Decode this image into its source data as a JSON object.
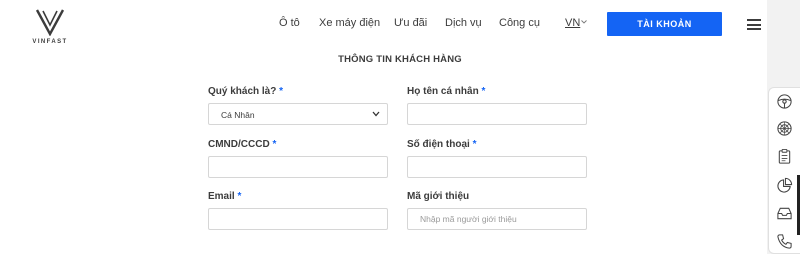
{
  "brand": {
    "logo_text": "VINFAST"
  },
  "nav": {
    "items": [
      "Ô tô",
      "Xe máy điện",
      "Ưu đãi",
      "Dịch vụ",
      "Công cụ"
    ],
    "language": "VN",
    "account_label": "TÀI KHOẢN"
  },
  "form": {
    "title": "THÔNG TIN KHÁCH HÀNG",
    "customer_type": {
      "label": "Quý khách là?",
      "required": "*",
      "value": "Cá Nhân"
    },
    "full_name": {
      "label": "Họ tên cá nhân",
      "required": "*",
      "value": ""
    },
    "id_number": {
      "label": "CMND/CCCD",
      "required": "*",
      "value": ""
    },
    "phone": {
      "label": "Số điện thoại",
      "required": "*",
      "value": ""
    },
    "email": {
      "label": "Email",
      "required": "*",
      "value": ""
    },
    "referral": {
      "label": "Mã giới thiệu",
      "placeholder": "Nhập mã người giới thiệu",
      "value": ""
    }
  },
  "side_tools": {
    "icons": [
      "steering-wheel-icon",
      "wheel-icon",
      "clipboard-icon",
      "pie-chart-icon",
      "inbox-icon",
      "phone-icon"
    ]
  },
  "colors": {
    "accent": "#1464f4",
    "text": "#3c3c3c",
    "border": "#d6d6d6"
  }
}
